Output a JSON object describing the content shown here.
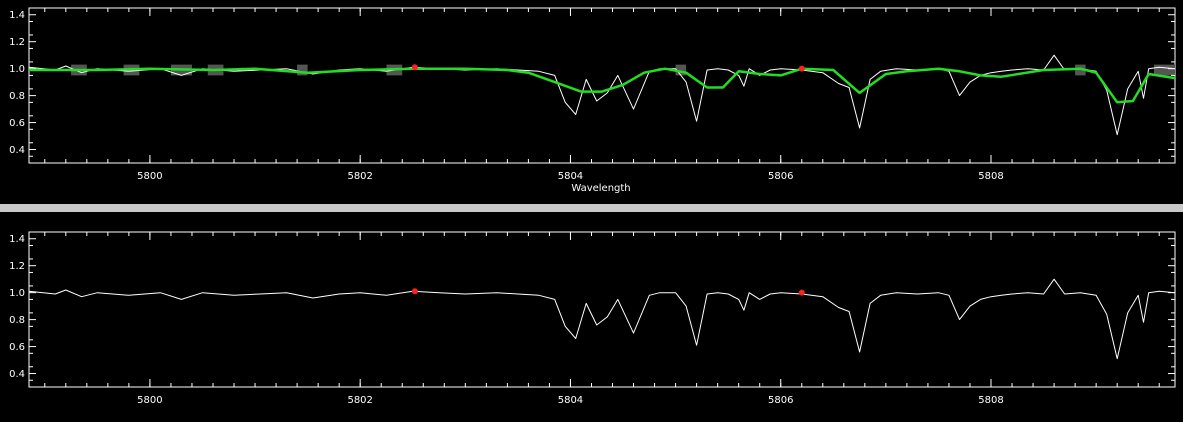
{
  "colors": {
    "background": "#000000",
    "axes": "#ffffff",
    "spectrum": "#ffffff",
    "fit": "#22dd22",
    "masked": "#555555",
    "anchor": "#ff2020",
    "separator": "#c8c8c8"
  },
  "chart_data": [
    {
      "type": "line",
      "title": "",
      "xlabel": "Wavelength",
      "ylabel": "",
      "xlim": [
        5798.85,
        5809.75
      ],
      "ylim": [
        0.3,
        1.45
      ],
      "xticks": [
        5800,
        5802,
        5804,
        5806,
        5808
      ],
      "yticks": [
        0.4,
        0.6,
        0.8,
        1.0,
        1.2,
        1.4
      ],
      "xtick_labels": [
        "5800",
        "5802",
        "5804",
        "5806",
        "5808"
      ],
      "ytick_labels": [
        "0.4",
        "0.6",
        "0.8",
        "1.0",
        "1.2",
        "1.4"
      ],
      "grid": false,
      "anchor_points": [
        [
          5802.52,
          1.01
        ],
        [
          5806.2,
          1.0
        ]
      ],
      "masked_regions": [
        [
          5799.25,
          5799.4
        ],
        [
          5799.75,
          5799.9
        ],
        [
          5800.2,
          5800.4
        ],
        [
          5800.55,
          5800.7
        ],
        [
          5801.4,
          5801.5
        ],
        [
          5802.25,
          5802.4
        ],
        [
          5805.0,
          5805.1
        ],
        [
          5808.8,
          5808.9
        ],
        [
          5809.55,
          5809.75
        ]
      ],
      "series": [
        {
          "kind": "spectrum",
          "x": [
            5798.85,
            5799.1,
            5799.2,
            5799.35,
            5799.5,
            5799.8,
            5800.1,
            5800.3,
            5800.5,
            5800.8,
            5801.05,
            5801.3,
            5801.55,
            5801.8,
            5802.0,
            5802.25,
            5802.5,
            5802.75,
            5803.0,
            5803.3,
            5803.5,
            5803.7,
            5803.85,
            5803.95,
            5804.05,
            5804.15,
            5804.25,
            5804.35,
            5804.45,
            5804.6,
            5804.75,
            5804.85,
            5805.0,
            5805.1,
            5805.2,
            5805.3,
            5805.4,
            5805.5,
            5805.6,
            5805.65,
            5805.7,
            5805.8,
            5805.9,
            5806.0,
            5806.2,
            5806.4,
            5806.55,
            5806.65,
            5806.75,
            5806.85,
            5806.95,
            5807.1,
            5807.3,
            5807.5,
            5807.6,
            5807.7,
            5807.8,
            5807.9,
            5808.0,
            5808.1,
            5808.2,
            5808.35,
            5808.5,
            5808.6,
            5808.7,
            5808.85,
            5809.0,
            5809.1,
            5809.2,
            5809.3,
            5809.4,
            5809.45,
            5809.5,
            5809.6,
            5809.75
          ],
          "y": [
            1.01,
            0.99,
            1.02,
            0.97,
            1.0,
            0.98,
            1.0,
            0.95,
            1.0,
            0.98,
            0.99,
            1.0,
            0.96,
            0.99,
            1.0,
            0.98,
            1.01,
            1.0,
            0.99,
            1.0,
            0.99,
            0.98,
            0.95,
            0.75,
            0.66,
            0.92,
            0.76,
            0.82,
            0.95,
            0.7,
            0.98,
            1.0,
            1.0,
            0.9,
            0.61,
            0.99,
            1.0,
            0.99,
            0.95,
            0.87,
            1.0,
            0.95,
            0.99,
            1.0,
            0.99,
            0.97,
            0.89,
            0.86,
            0.56,
            0.92,
            0.98,
            1.0,
            0.99,
            1.0,
            0.98,
            0.8,
            0.9,
            0.95,
            0.97,
            0.98,
            0.99,
            1.0,
            0.99,
            1.1,
            0.99,
            1.0,
            0.98,
            0.84,
            0.51,
            0.85,
            0.98,
            0.78,
            1.0,
            1.01,
            1.0
          ]
        },
        {
          "kind": "fit",
          "x": [
            5798.85,
            5799.5,
            5800.0,
            5800.6,
            5801.0,
            5801.5,
            5802.0,
            5802.5,
            5803.0,
            5803.4,
            5803.6,
            5803.85,
            5804.1,
            5804.3,
            5804.5,
            5804.7,
            5804.9,
            5805.1,
            5805.3,
            5805.45,
            5805.6,
            5805.8,
            5806.0,
            5806.2,
            5806.5,
            5806.75,
            5807.0,
            5807.2,
            5807.5,
            5807.7,
            5807.9,
            5808.1,
            5808.5,
            5808.85,
            5809.0,
            5809.2,
            5809.35,
            5809.5,
            5809.75
          ],
          "y": [
            0.99,
            0.99,
            1.0,
            0.99,
            1.0,
            0.97,
            0.99,
            1.0,
            1.0,
            0.99,
            0.97,
            0.9,
            0.83,
            0.83,
            0.88,
            0.97,
            1.0,
            0.97,
            0.86,
            0.86,
            0.98,
            0.96,
            0.95,
            1.0,
            0.99,
            0.82,
            0.96,
            0.98,
            1.0,
            0.98,
            0.95,
            0.94,
            0.99,
            1.0,
            0.97,
            0.75,
            0.76,
            0.96,
            0.93
          ]
        }
      ]
    },
    {
      "type": "line",
      "title": "",
      "xlabel": "",
      "ylabel": "",
      "xlim": [
        5798.85,
        5809.75
      ],
      "ylim": [
        0.3,
        1.45
      ],
      "xticks": [
        5800,
        5802,
        5804,
        5806,
        5808
      ],
      "yticks": [
        0.4,
        0.6,
        0.8,
        1.0,
        1.2,
        1.4
      ],
      "xtick_labels": [
        "5800",
        "5802",
        "5804",
        "5806",
        "5808"
      ],
      "ytick_labels": [
        "0.4",
        "0.6",
        "0.8",
        "1.0",
        "1.2",
        "1.4"
      ],
      "grid": false,
      "anchor_points": [
        [
          5802.52,
          1.01
        ],
        [
          5806.2,
          1.0
        ]
      ],
      "series": [
        {
          "kind": "spectrum",
          "x": [
            5798.85,
            5799.1,
            5799.2,
            5799.35,
            5799.5,
            5799.8,
            5800.1,
            5800.3,
            5800.5,
            5800.8,
            5801.05,
            5801.3,
            5801.55,
            5801.8,
            5802.0,
            5802.25,
            5802.5,
            5802.75,
            5803.0,
            5803.3,
            5803.5,
            5803.7,
            5803.85,
            5803.95,
            5804.05,
            5804.15,
            5804.25,
            5804.35,
            5804.45,
            5804.6,
            5804.75,
            5804.85,
            5805.0,
            5805.1,
            5805.2,
            5805.3,
            5805.4,
            5805.5,
            5805.6,
            5805.65,
            5805.7,
            5805.8,
            5805.9,
            5806.0,
            5806.2,
            5806.4,
            5806.55,
            5806.65,
            5806.75,
            5806.85,
            5806.95,
            5807.1,
            5807.3,
            5807.5,
            5807.6,
            5807.7,
            5807.8,
            5807.9,
            5808.0,
            5808.1,
            5808.2,
            5808.35,
            5808.5,
            5808.6,
            5808.7,
            5808.85,
            5809.0,
            5809.1,
            5809.2,
            5809.3,
            5809.4,
            5809.45,
            5809.5,
            5809.6,
            5809.75
          ],
          "y": [
            1.01,
            0.99,
            1.02,
            0.97,
            1.0,
            0.98,
            1.0,
            0.95,
            1.0,
            0.98,
            0.99,
            1.0,
            0.96,
            0.99,
            1.0,
            0.98,
            1.01,
            1.0,
            0.99,
            1.0,
            0.99,
            0.98,
            0.95,
            0.75,
            0.66,
            0.92,
            0.76,
            0.82,
            0.95,
            0.7,
            0.98,
            1.0,
            1.0,
            0.9,
            0.61,
            0.99,
            1.0,
            0.99,
            0.95,
            0.87,
            1.0,
            0.95,
            0.99,
            1.0,
            0.99,
            0.97,
            0.89,
            0.86,
            0.56,
            0.92,
            0.98,
            1.0,
            0.99,
            1.0,
            0.98,
            0.8,
            0.9,
            0.95,
            0.97,
            0.98,
            0.99,
            1.0,
            0.99,
            1.1,
            0.99,
            1.0,
            0.98,
            0.84,
            0.51,
            0.85,
            0.98,
            0.78,
            1.0,
            1.01,
            1.0
          ]
        }
      ]
    }
  ]
}
